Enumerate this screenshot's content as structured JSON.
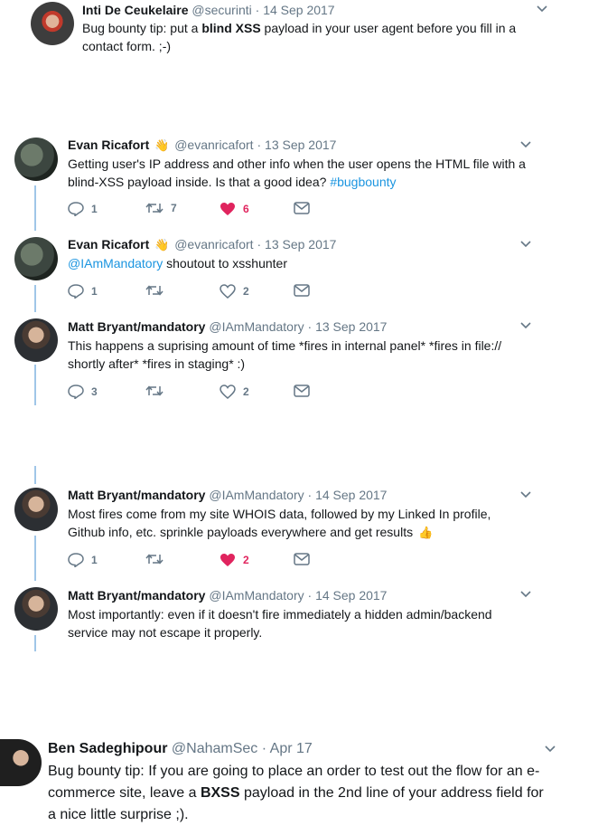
{
  "tweets": [
    {
      "name": "Inti De Ceukelaire",
      "handle": "@securinti",
      "date": "14 Sep 2017",
      "text_before": "Bug bounty tip: put a ",
      "text_bold": "blind XSS",
      "text_after": " payload in your user agent before you fill in a contact form. ;-)"
    },
    {
      "name": "Evan Ricafort",
      "handle": "@evanricafort",
      "date": "13 Sep 2017",
      "text": "Getting user's IP address and other info when the user opens the HTML file with a blind-XSS payload inside. Is that a good idea?",
      "hashtag": "#bugbounty",
      "replies": "1",
      "retweets": "7",
      "likes": "6"
    },
    {
      "name": "Evan Ricafort",
      "handle": "@evanricafort",
      "date": "13 Sep 2017",
      "mention": "@IAmMandatory",
      "text": " shoutout to xsshunter",
      "replies": "1",
      "retweets": "",
      "likes": "2"
    },
    {
      "name": "Matt Bryant/mandatory",
      "handle": "@IAmMandatory",
      "date": "13 Sep 2017",
      "text": "This happens a suprising amount of time *fires in internal panel* *fires in file:// shortly after* *fires in staging* :)",
      "replies": "3",
      "retweets": "",
      "likes": "2"
    },
    {
      "name": "Matt Bryant/mandatory",
      "handle": "@IAmMandatory",
      "date": "14 Sep 2017",
      "text": "Most fires come from my site WHOIS data, followed by my Linked In profile, Github info, etc. sprinkle payloads everywhere and get results",
      "replies": "1",
      "retweets": "",
      "likes": "2"
    },
    {
      "name": "Matt Bryant/mandatory",
      "handle": "@IAmMandatory",
      "date": "14 Sep 2017",
      "text": "Most importantly: even if it doesn't fire immediately a hidden admin/backend service may not escape it properly."
    },
    {
      "name": "Ben Sadeghipour",
      "handle": "@NahamSec",
      "date": "Apr 17",
      "text_before": "Bug bounty tip: If you are going to place an order to test out the flow for an e-commerce site, leave a ",
      "text_bold": "BXSS",
      "text_after": " payload in the 2nd line of your address field for a nice little surprise ;)."
    }
  ],
  "separator": "·",
  "colors": {
    "link": "#1b95e0",
    "like": "#e0245e",
    "muted": "#657786",
    "thread": "#a0c6e8"
  },
  "icons": [
    "chevron-down-icon",
    "reply-icon",
    "retweet-icon",
    "heart-icon",
    "message-icon",
    "waving-hand-icon",
    "thumbs-up-icon"
  ]
}
